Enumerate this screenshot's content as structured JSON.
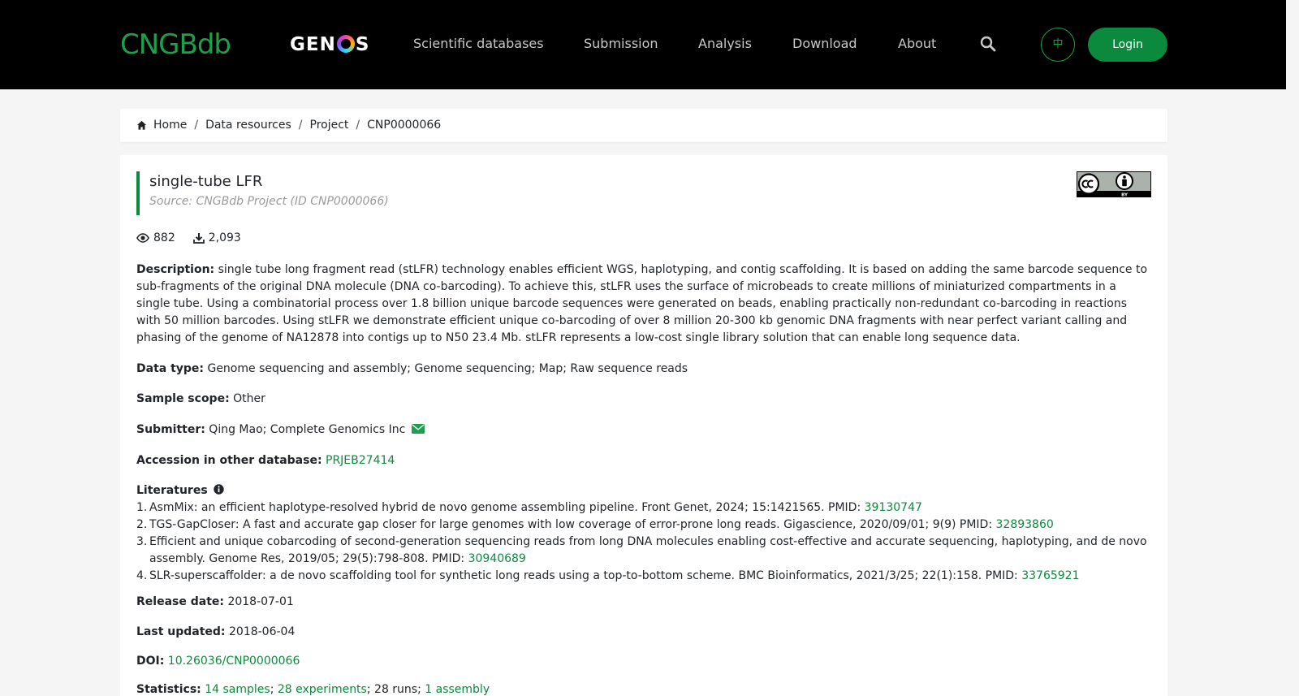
{
  "header": {
    "brand": "CNGBdb",
    "partner_brand_pre": "GEN",
    "partner_brand_post": "S",
    "nav": [
      "Scientific databases",
      "Submission",
      "Analysis",
      "Download",
      "About"
    ],
    "lang_label": "中",
    "login_label": "Login",
    "icons": {
      "search": "search-icon"
    },
    "colors": {
      "accent": "#0b8a3d",
      "brand": "#1aa14a",
      "header_bg": "#000000"
    }
  },
  "breadcrumb": [
    "Home",
    "Data resources",
    "Project",
    "CNP0000066"
  ],
  "project": {
    "title": "single-tube LFR",
    "source": "Source: CNGBdb Project (ID CNP0000066)",
    "views": "882",
    "downloads": "2,093",
    "description_label": "Description:",
    "description": "single tube long fragment read (stLFR) technology enables efficient WGS, haplotyping, and contig scaffolding. It is based on adding the same barcode sequence to sub-fragments of the original DNA molecule (DNA co-barcoding). To achieve this, stLFR uses the surface of microbeads to create millions of miniaturized compartments in a single tube. Using a combinatorial process over 1.8 billion unique barcode sequences were generated on beads, enabling practically non-redundant co-barcoding in reactions with 50 million barcodes. Using stLFR we demonstrate efficient unique co-barcoding of over 8 million 20-300 kb genomic DNA fragments with near perfect variant calling and phasing of the genome of NA12878 into contigs up to N50 23.4 Mb. stLFR represents a low-cost single library solution that can enable long sequence data.",
    "data_type_label": "Data type:",
    "data_type": "Genome sequencing and assembly; Genome sequencing; Map; Raw sequence reads",
    "sample_scope_label": "Sample scope:",
    "sample_scope": "Other",
    "submitter_label": "Submitter:",
    "submitter": "Qing Mao; Complete Genomics Inc",
    "accession_label": "Accession in other database:",
    "accession": "PRJEB27414",
    "literatures_label": "Literatures",
    "literatures": [
      {
        "text": "AsmMix: an efficient haplotype-resolved hybrid de novo genome assembling pipeline. Front Genet, 2024; 15:1421565. PMID: ",
        "pmid": "39130747"
      },
      {
        "text": "TGS-GapCloser: A fast and accurate gap closer for large genomes with low coverage of error-prone long reads. Gigascience, 2020/09/01; 9(9) PMID: ",
        "pmid": "32893860"
      },
      {
        "text": "Efficient and unique cobarcoding of second-generation sequencing reads from long DNA molecules enabling cost-effective and accurate sequencing, haplotyping, and de novo assembly. Genome Res, 2019/05; 29(5):798-808. PMID: ",
        "pmid": "30940689"
      },
      {
        "text": "SLR-superscaffolder: a de novo scaffolding tool for synthetic long reads using a top-to-bottom scheme. BMC Bioinformatics, 2021/3/25; 22(1):158. PMID: ",
        "pmid": "33765921"
      }
    ],
    "release_label": "Release date:",
    "release_date": "2018-07-01",
    "updated_label": "Last updated:",
    "last_updated": "2018-06-04",
    "doi_label": "DOI:",
    "doi": "10.26036/CNP0000066",
    "statistics_label": "Statistics:",
    "statistics": {
      "samples": "14 samples",
      "experiments": "28 experiments",
      "runs": "28 runs",
      "assembly": "1 assembly"
    }
  }
}
